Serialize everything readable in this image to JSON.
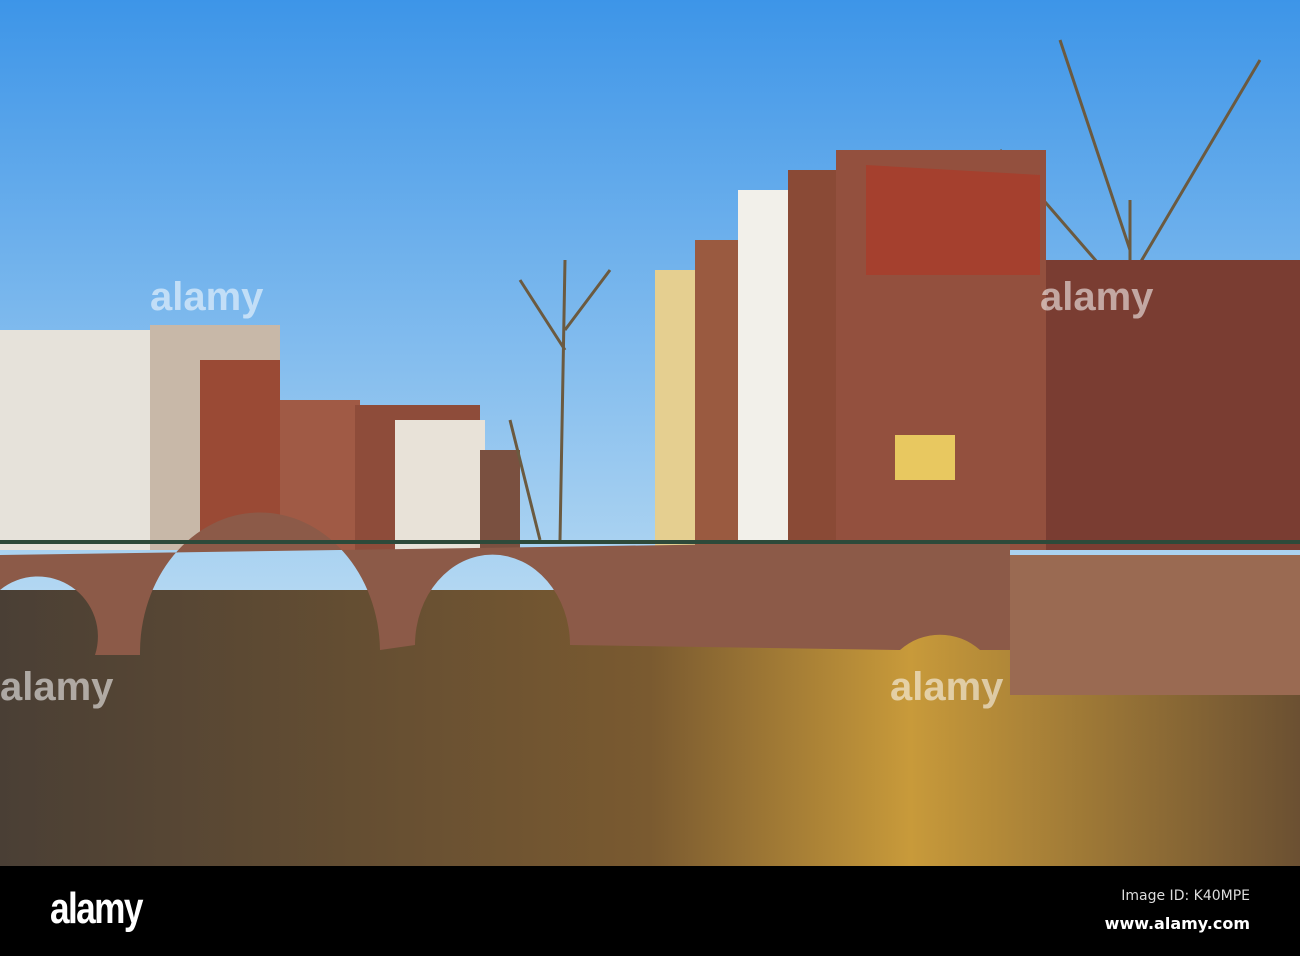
{
  "watermark": {
    "text": "alamy"
  },
  "footer": {
    "logo": "alamy",
    "image_id": "Image ID: K40MPE",
    "website": "www.alamy.com"
  },
  "colors": {
    "sky_top": "#3d95e8",
    "sky_bottom": "#b4d8f2",
    "water": "#5b4835",
    "brick": "#8c5a48",
    "footer": "#000000"
  }
}
